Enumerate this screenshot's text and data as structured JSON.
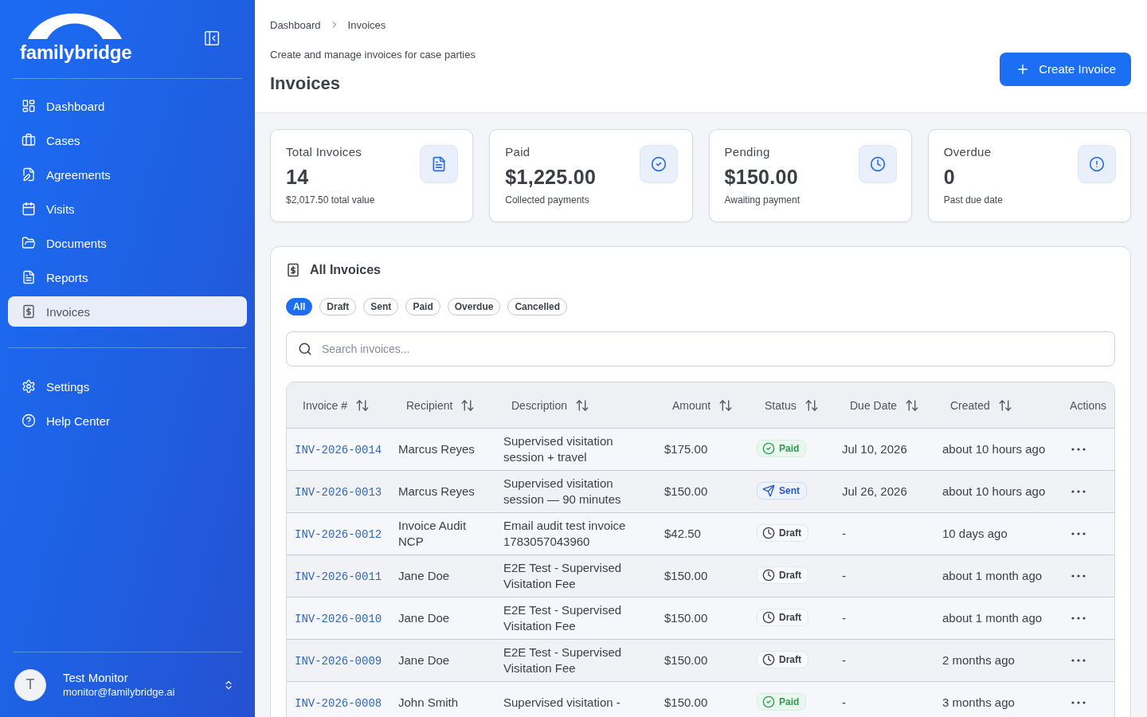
{
  "sidebar": {
    "logo_text": "familybridge",
    "nav_items": [
      {
        "label": "Dashboard",
        "selected": false
      },
      {
        "label": "Cases",
        "selected": false
      },
      {
        "label": "Agreements",
        "selected": false
      },
      {
        "label": "Visits",
        "selected": false
      },
      {
        "label": "Documents",
        "selected": false
      },
      {
        "label": "Reports",
        "selected": false
      },
      {
        "label": "Invoices",
        "selected": true
      }
    ],
    "secondary_items": [
      {
        "label": "Settings",
        "selected": false
      },
      {
        "label": "Help Center",
        "selected": false
      }
    ],
    "user": {
      "initial": "T",
      "name": "Test Monitor",
      "email": "monitor@familybridge.ai"
    }
  },
  "header": {
    "breadcrumb": [
      "Dashboard",
      "Invoices"
    ],
    "subtitle": "Create and manage invoices for case parties",
    "title": "Invoices",
    "primary_button": "Create Invoice"
  },
  "stats": [
    {
      "label": "Total Invoices",
      "value": "14",
      "note": "$2,017.50 total value"
    },
    {
      "label": "Paid",
      "value": "$1,225.00",
      "note": "Collected payments"
    },
    {
      "label": "Pending",
      "value": "$150.00",
      "note": "Awaiting payment"
    },
    {
      "label": "Overdue",
      "value": "0",
      "note": "Past due date"
    }
  ],
  "invoices": {
    "title": "All Invoices",
    "filters": [
      {
        "label": "All",
        "selected": true
      },
      {
        "label": "Draft",
        "selected": false
      },
      {
        "label": "Sent",
        "selected": false
      },
      {
        "label": "Paid",
        "selected": false
      },
      {
        "label": "Overdue",
        "selected": false
      },
      {
        "label": "Cancelled",
        "selected": false
      }
    ],
    "search": {
      "placeholder": "Search invoices..."
    },
    "table": {
      "columns": [
        {
          "label": "Invoice #",
          "sortable": true
        },
        {
          "label": "Recipient",
          "sortable": true
        },
        {
          "label": "Description",
          "sortable": true
        },
        {
          "label": "Amount",
          "sortable": true
        },
        {
          "label": "Status",
          "sortable": true
        },
        {
          "label": "Due Date",
          "sortable": true
        },
        {
          "label": "Created",
          "sortable": true
        },
        {
          "label": "Actions",
          "sortable": false
        }
      ],
      "rows": [
        {
          "invoice": "INV-2026-0014",
          "recipient": "Marcus Reyes",
          "description": "Supervised visitation session + travel",
          "amount": "$175.00",
          "status": {
            "label": "Paid",
            "kind": "paid"
          },
          "due_date": "Jul 10, 2026",
          "created": "about 10 hours ago"
        },
        {
          "invoice": "INV-2026-0013",
          "recipient": "Marcus Reyes",
          "description": "Supervised visitation session — 90 minutes",
          "amount": "$150.00",
          "status": {
            "label": "Sent",
            "kind": "sent"
          },
          "due_date": "Jul 26, 2026",
          "created": "about 10 hours ago"
        },
        {
          "invoice": "INV-2026-0012",
          "recipient": "Invoice Audit NCP",
          "description": "Email audit test invoice 1783057043960",
          "amount": "$42.50",
          "status": {
            "label": "Draft",
            "kind": "draft"
          },
          "due_date": "-",
          "created": "10 days ago"
        },
        {
          "invoice": "INV-2026-0011",
          "recipient": "Jane Doe",
          "description": "E2E Test - Supervised Visitation Fee",
          "amount": "$150.00",
          "status": {
            "label": "Draft",
            "kind": "draft"
          },
          "due_date": "-",
          "created": "about 1 month ago"
        },
        {
          "invoice": "INV-2026-0010",
          "recipient": "Jane Doe",
          "description": "E2E Test - Supervised Visitation Fee",
          "amount": "$150.00",
          "status": {
            "label": "Draft",
            "kind": "draft"
          },
          "due_date": "-",
          "created": "about 1 month ago"
        },
        {
          "invoice": "INV-2026-0009",
          "recipient": "Jane Doe",
          "description": "E2E Test - Supervised Visitation Fee",
          "amount": "$150.00",
          "status": {
            "label": "Draft",
            "kind": "draft"
          },
          "due_date": "-",
          "created": "2 months ago"
        },
        {
          "invoice": "INV-2026-0008",
          "recipient": "John Smith",
          "description": "Supervised visitation -",
          "amount": "$150.00",
          "status": {
            "label": "Paid",
            "kind": "paid"
          },
          "due_date": "-",
          "created": "3 months ago"
        }
      ]
    }
  }
}
